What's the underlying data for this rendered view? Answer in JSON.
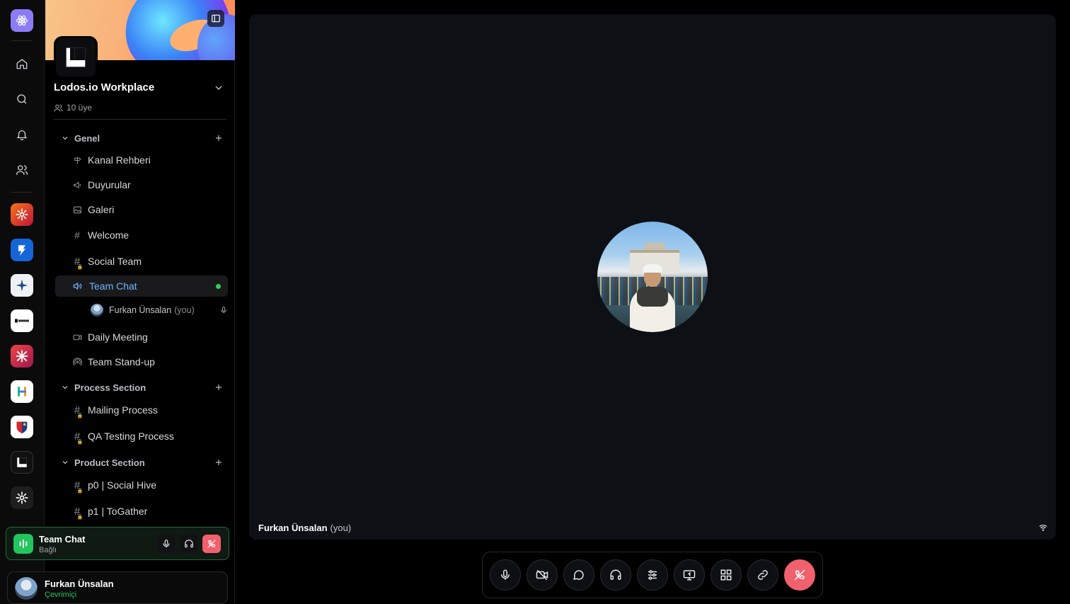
{
  "rail": {
    "items": [
      {
        "name": "atom-app-icon"
      },
      {
        "name": "home-icon"
      },
      {
        "name": "search-icon"
      },
      {
        "name": "bell-icon"
      },
      {
        "name": "users-icon"
      }
    ],
    "servers": [
      {
        "name": "server-flower-orange",
        "color": "#e3572c"
      },
      {
        "name": "server-arrow-blue",
        "color": "#1565d8"
      },
      {
        "name": "server-star-white",
        "color": "#f1f1f1"
      },
      {
        "name": "server-vazek",
        "color": "#ffffff"
      },
      {
        "name": "server-crossed-pink",
        "color": "#c2185b"
      },
      {
        "name": "server-h-white",
        "color": "#ffffff"
      },
      {
        "name": "server-badge",
        "color": "#ffffff"
      },
      {
        "name": "server-lodos",
        "color": "#111111"
      },
      {
        "name": "server-flower-dark",
        "color": "#1e1e1e"
      }
    ]
  },
  "workspace": {
    "name": "Lodos.io Workplace",
    "members": "10 üye"
  },
  "sections": [
    {
      "title": "Genel",
      "channels": [
        {
          "label": "Kanal Rehberi",
          "icon": "signpost-icon"
        },
        {
          "label": "Duyurular",
          "icon": "megaphone-icon"
        },
        {
          "label": "Galeri",
          "icon": "image-icon"
        },
        {
          "label": "Welcome",
          "icon": "hash-icon"
        },
        {
          "label": "Social Team",
          "icon": "hash-lock-icon"
        },
        {
          "label": "Team Chat",
          "icon": "speaker-icon",
          "active": true
        },
        {
          "label": "Daily Meeting",
          "icon": "video-icon"
        },
        {
          "label": "Team Stand-up",
          "icon": "broadcast-icon"
        }
      ]
    },
    {
      "title": "Process Section",
      "channels": [
        {
          "label": "Mailing Process",
          "icon": "hash-lock-icon"
        },
        {
          "label": "QA Testing Process",
          "icon": "hash-lock-icon"
        }
      ]
    },
    {
      "title": "Product Section",
      "channels": [
        {
          "label": "p0 | Social Hive",
          "icon": "hash-lock-icon"
        },
        {
          "label": "p1 | ToGather",
          "icon": "hash-lock-icon"
        }
      ]
    }
  ],
  "voice_member": {
    "name": "Furkan Ünsalan",
    "suffix": "(you)"
  },
  "voice_box": {
    "title": "Team Chat",
    "status": "Bağlı"
  },
  "user": {
    "name": "Furkan Ünsalan",
    "status": "Çevrimiçi"
  },
  "stage": {
    "participant": "Furkan Ünsalan",
    "suffix": "(you)"
  },
  "controls": [
    {
      "name": "mic-icon"
    },
    {
      "name": "camera-off-icon"
    },
    {
      "name": "chat-icon"
    },
    {
      "name": "headphones-icon"
    },
    {
      "name": "sliders-icon"
    },
    {
      "name": "screen-share-icon"
    },
    {
      "name": "layout-grid-icon"
    },
    {
      "name": "link-icon"
    },
    {
      "name": "end-call-icon"
    }
  ],
  "colors": {
    "accent": "#6cb6ff",
    "online": "#22c55e",
    "danger": "#f0616d"
  }
}
